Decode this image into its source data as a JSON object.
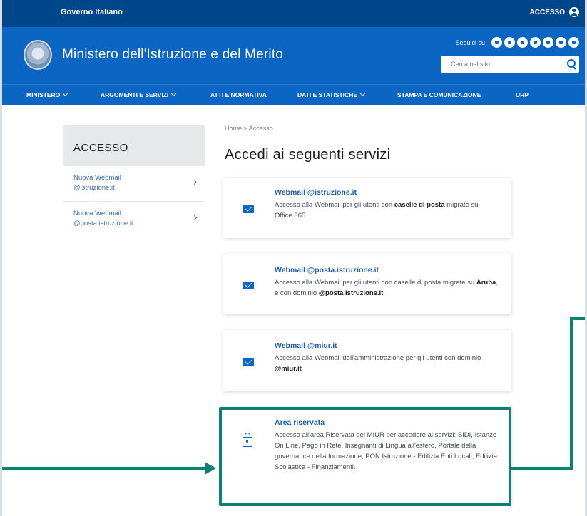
{
  "govbar": {
    "label": "Governo Italiano",
    "login_label": "ACCESSO"
  },
  "header": {
    "title": "Ministero dell'Istruzione e del Merito",
    "follow_label": "Seguici su",
    "search_placeholder": "Cerca nel sito",
    "social_icons": [
      "twitter-icon",
      "facebook-icon",
      "instagram-icon",
      "youtube-icon",
      "telegram-icon",
      "linkedin-icon",
      "whatsapp-icon"
    ]
  },
  "nav": {
    "items": [
      {
        "label": "MINISTERO"
      },
      {
        "label": "ARGOMENTI E SERVIZI"
      },
      {
        "label": "ATTI E NORMATIVA"
      },
      {
        "label": "DATI E STATISTICHE"
      },
      {
        "label": "STAMPA E COMUNICAZIONE"
      },
      {
        "label": "URP"
      }
    ]
  },
  "sidebar": {
    "heading": "ACCESSO",
    "items": [
      {
        "label": "Nuova Webmail @istruzione.it"
      },
      {
        "label": "Nuova Webmail @posta.istruzione.it"
      }
    ]
  },
  "main": {
    "breadcrumb": "Home > Accesso",
    "title": "Accedi ai seguenti servizi",
    "cards": [
      {
        "title": "Webmail @istruzione.it",
        "desc_parts": [
          "Accesso alla Webmail per gli utenti con ",
          "caselle di posta",
          " migrate su Office 365."
        ],
        "icon": "mail-icon"
      },
      {
        "title": "Webmail @posta.istruzione.it",
        "desc_parts": [
          "Accesso alla Webmail per gli utenti con caselle di posta migrate su ",
          "Aruba",
          ", e con dominio ",
          "@posta.istruzione.it"
        ],
        "icon": "mail-icon"
      },
      {
        "title": "Webmail @miur.it",
        "desc_parts": [
          "Accesso alla Webmail dell'amministrazione per gli utenti con dominio ",
          "@miur.it"
        ],
        "icon": "mail-icon"
      },
      {
        "title": "Area riservata",
        "desc": "Accesso all'area Riservata del MIUR per accedere ai servizi: SIDI, Istanze On Line, Pago in Rete, Insegnanti di Lingua all'estero, Portale della governance della formazione, PON Istruzione - Edilizia Enti Locali, Edilizia Scolastica - Finanziamenti.",
        "icon": "lock-icon"
      }
    ]
  },
  "colors": {
    "brand": "#0a66c2",
    "topbar": "#00468a",
    "highlight": "#0b8074"
  }
}
